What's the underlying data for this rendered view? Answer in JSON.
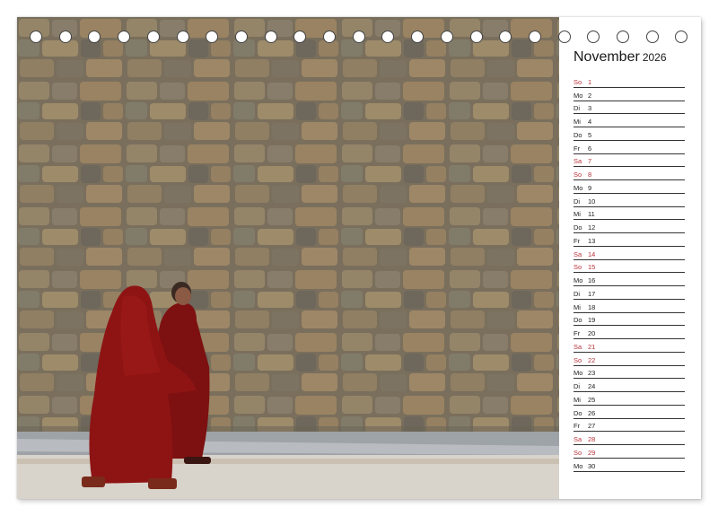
{
  "calendar": {
    "month": "November",
    "year": "2026",
    "days": [
      {
        "weekday": "So",
        "day": "1",
        "weekend": true
      },
      {
        "weekday": "Mo",
        "day": "2",
        "weekend": false
      },
      {
        "weekday": "Di",
        "day": "3",
        "weekend": false
      },
      {
        "weekday": "Mi",
        "day": "4",
        "weekend": false
      },
      {
        "weekday": "Do",
        "day": "5",
        "weekend": false
      },
      {
        "weekday": "Fr",
        "day": "6",
        "weekend": false
      },
      {
        "weekday": "Sa",
        "day": "7",
        "weekend": true
      },
      {
        "weekday": "So",
        "day": "8",
        "weekend": true
      },
      {
        "weekday": "Mo",
        "day": "9",
        "weekend": false
      },
      {
        "weekday": "Di",
        "day": "10",
        "weekend": false
      },
      {
        "weekday": "Mi",
        "day": "11",
        "weekend": false
      },
      {
        "weekday": "Do",
        "day": "12",
        "weekend": false
      },
      {
        "weekday": "Fr",
        "day": "13",
        "weekend": false
      },
      {
        "weekday": "Sa",
        "day": "14",
        "weekend": true
      },
      {
        "weekday": "So",
        "day": "15",
        "weekend": true
      },
      {
        "weekday": "Mo",
        "day": "16",
        "weekend": false
      },
      {
        "weekday": "Di",
        "day": "17",
        "weekend": false
      },
      {
        "weekday": "Mi",
        "day": "18",
        "weekend": false
      },
      {
        "weekday": "Do",
        "day": "19",
        "weekend": false
      },
      {
        "weekday": "Fr",
        "day": "20",
        "weekend": false
      },
      {
        "weekday": "Sa",
        "day": "21",
        "weekend": true
      },
      {
        "weekday": "So",
        "day": "22",
        "weekend": true
      },
      {
        "weekday": "Mo",
        "day": "23",
        "weekend": false
      },
      {
        "weekday": "Di",
        "day": "24",
        "weekend": false
      },
      {
        "weekday": "Mi",
        "day": "25",
        "weekend": false
      },
      {
        "weekday": "Do",
        "day": "26",
        "weekend": false
      },
      {
        "weekday": "Fr",
        "day": "27",
        "weekend": false
      },
      {
        "weekday": "Sa",
        "day": "28",
        "weekend": true
      },
      {
        "weekday": "So",
        "day": "29",
        "weekend": true
      },
      {
        "weekday": "Mo",
        "day": "30",
        "weekend": false
      }
    ]
  },
  "binding": {
    "ring_count": 23
  },
  "colors": {
    "weekend": "#b8323b",
    "weekday": "#222222",
    "robe": "#8e1414"
  },
  "photo": {
    "subject": "photo"
  }
}
